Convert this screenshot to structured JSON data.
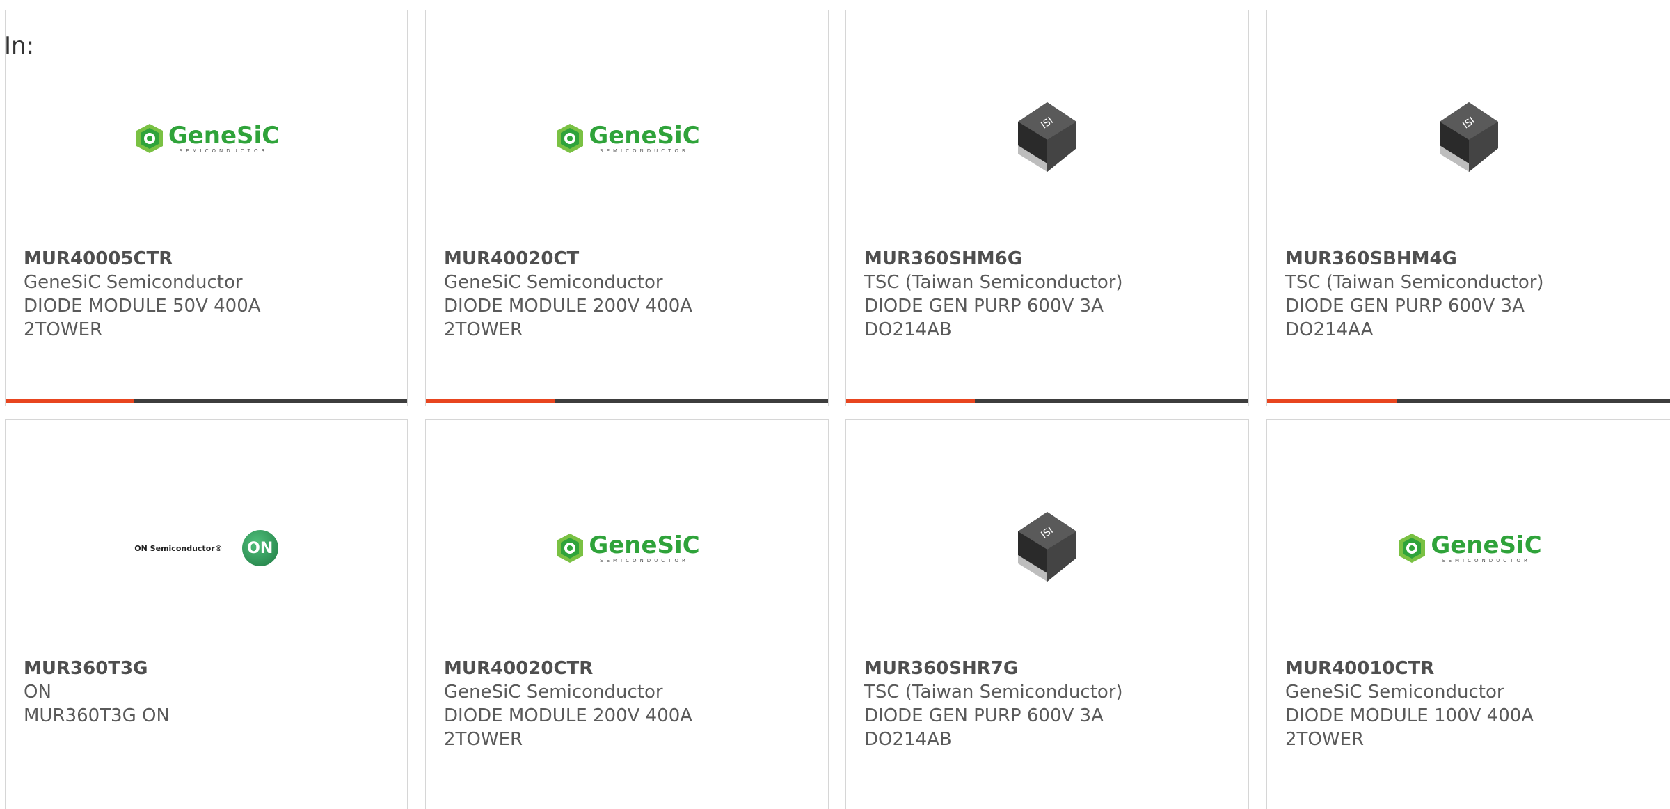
{
  "page": {
    "heading": "In:"
  },
  "colors": {
    "accent": "#e8451f",
    "bar_track": "#3d3d3d",
    "genesic_green": "#2fa33a",
    "on_green": "#2e9a58"
  },
  "products": [
    {
      "part_number": "MUR40005CTR",
      "manufacturer": "GeneSiC Semiconductor",
      "desc_line1": "DIODE MODULE 50V 400A",
      "desc_line2": "2TOWER",
      "image": "genesic-logo",
      "progress": 0.32
    },
    {
      "part_number": "MUR40020CT",
      "manufacturer": "GeneSiC Semiconductor",
      "desc_line1": "DIODE MODULE 200V 400A",
      "desc_line2": "2TOWER",
      "image": "genesic-logo",
      "progress": 0.32
    },
    {
      "part_number": "MUR360SHM6G",
      "manufacturer": "TSC (Taiwan Semiconductor)",
      "desc_line1": "DIODE GEN PURP 600V 3A",
      "desc_line2": "DO214AB",
      "image": "smd-diode-package",
      "progress": 0.32
    },
    {
      "part_number": "MUR360SBHM4G",
      "manufacturer": "TSC (Taiwan Semiconductor)",
      "desc_line1": "DIODE GEN PURP 600V 3A",
      "desc_line2": "DO214AA",
      "image": "smd-diode-package",
      "progress": 0.32
    },
    {
      "part_number": "MUR360T3G",
      "manufacturer": "ON",
      "desc_line1": "MUR360T3G ON",
      "desc_line2": "",
      "image": "on-semiconductor-logo",
      "logo_text": "ON Semiconductor®",
      "logo_mark": "ON"
    },
    {
      "part_number": "MUR40020CTR",
      "manufacturer": "GeneSiC Semiconductor",
      "desc_line1": "DIODE MODULE 200V 400A",
      "desc_line2": "2TOWER",
      "image": "genesic-logo"
    },
    {
      "part_number": "MUR360SHR7G",
      "manufacturer": "TSC (Taiwan Semiconductor)",
      "desc_line1": "DIODE GEN PURP 600V 3A",
      "desc_line2": "DO214AB",
      "image": "smd-diode-package"
    },
    {
      "part_number": "MUR40010CTR",
      "manufacturer": "GeneSiC Semiconductor",
      "desc_line1": "DIODE MODULE 100V 400A",
      "desc_line2": "2TOWER",
      "image": "genesic-logo"
    }
  ],
  "genesic_logo": {
    "title": "GeneSiC",
    "sub": "SEMICONDUCTOR"
  }
}
